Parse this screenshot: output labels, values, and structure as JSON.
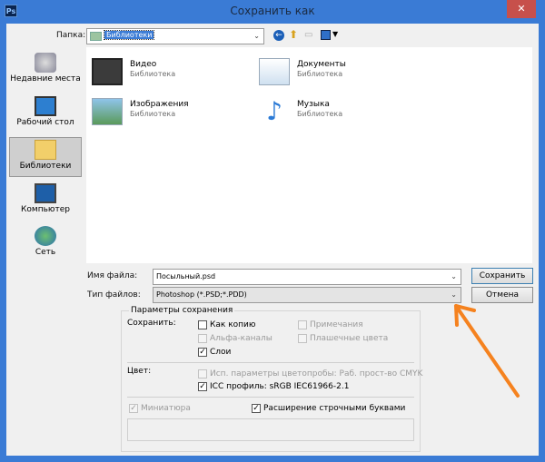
{
  "window": {
    "title": "Сохранить как",
    "app_icon": "Ps",
    "close": "✕"
  },
  "folder": {
    "label": "Папка:",
    "value": "Библиотеки"
  },
  "sidebar": {
    "items": [
      {
        "label": "Недавние места",
        "icon": "recent-places-icon"
      },
      {
        "label": "Рабочий стол",
        "icon": "desktop-icon"
      },
      {
        "label": "Библиотеки",
        "icon": "libraries-icon",
        "selected": true
      },
      {
        "label": "Компьютер",
        "icon": "computer-icon"
      },
      {
        "label": "Сеть",
        "icon": "network-icon"
      }
    ]
  },
  "files": [
    {
      "name": "Видео",
      "type": "Библиотека"
    },
    {
      "name": "Документы",
      "type": "Библиотека"
    },
    {
      "name": "Изображения",
      "type": "Библиотека"
    },
    {
      "name": "Музыка",
      "type": "Библиотека"
    }
  ],
  "filename": {
    "label": "Имя файла:",
    "value": "Посыльный.psd"
  },
  "filetype": {
    "label": "Тип файлов:",
    "value": "Photoshop (*.PSD;*.PDD)"
  },
  "buttons": {
    "save": "Сохранить",
    "cancel": "Отмена"
  },
  "options": {
    "title": "Параметры сохранения",
    "save_label": "Сохранить:",
    "as_copy": "Как копию",
    "notes": "Примечания",
    "alpha": "Альфа-каналы",
    "spot": "Плашечные цвета",
    "layers": "Слои",
    "color_label": "Цвет:",
    "use_proof": "Исп. параметры цветопробы:  Раб. прост-во CMYK",
    "icc": "ICC профиль:  sRGB IEC61966-2.1",
    "thumbnail": "Миниатюра",
    "lowercase": "Расширение строчными буквами"
  },
  "colors": {
    "titlebar": "#3a7bd5",
    "close": "#c7504b",
    "arrow": "#f5821f"
  }
}
